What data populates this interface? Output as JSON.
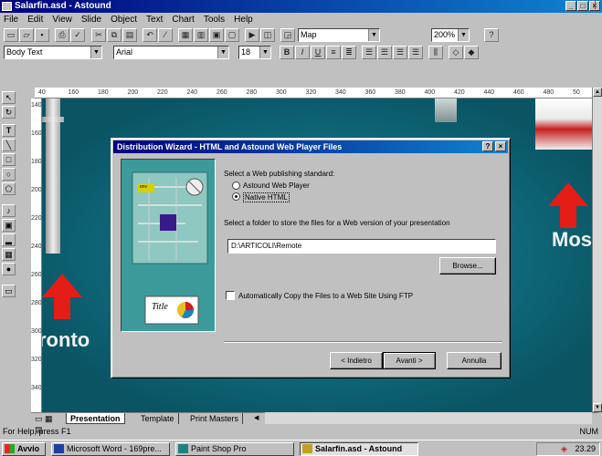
{
  "window": {
    "title": "Salarfin.asd - Astound",
    "controls": [
      "_",
      "□",
      "×"
    ]
  },
  "menu": [
    "File",
    "Edit",
    "View",
    "Slide",
    "Object",
    "Text",
    "Chart",
    "Tools",
    "Help"
  ],
  "toolbar": {
    "view_combo": "Map",
    "zoom_combo": "200%"
  },
  "format_bar": {
    "style_combo": "Body Text",
    "font_combo": "Arial",
    "size_combo": "18",
    "bold": "B",
    "italic": "I",
    "underline": "U"
  },
  "ruler": {
    "h_ticks": [
      "40",
      "160",
      "180",
      "200",
      "220",
      "240",
      "260",
      "280",
      "300",
      "320",
      "340",
      "360",
      "380",
      "400",
      "420",
      "440",
      "460",
      "480",
      "50"
    ],
    "v_ticks": [
      "140",
      "160",
      "180",
      "200",
      "220",
      "240",
      "260",
      "280",
      "300",
      "320",
      "340"
    ]
  },
  "slide": {
    "city_left": "ronto",
    "city_right": "Mosc",
    "colors": {
      "background": "#106f80",
      "arrow": "#e41d16"
    }
  },
  "dialog": {
    "title": "Distribution Wizard - HTML and Astound Web Player Files",
    "help_btn": "?",
    "close_btn": "×",
    "prompt_standard": "Select a Web publishing standard:",
    "option_astound": "Astound Web Player",
    "option_native": "Native HTML",
    "selected_option": "native",
    "prompt_folder": "Select a folder to store the files for a Web version of your presentation",
    "folder_value": "D:\\ARTICOLI\\Remote",
    "browse_btn": "Browse...",
    "ftp_checkbox": "Automatically Copy the Files to a Web Site Using FTP",
    "ftp_checked": false,
    "back_btn": "< Indietro",
    "next_btn": "Avanti >",
    "cancel_btn": "Annulla",
    "thumbnail_title": "Title",
    "badge": "env"
  },
  "tabs": {
    "presentation": "Presentation",
    "template": "Template",
    "print_masters": "Print Masters"
  },
  "status": {
    "help_text": "For Help, press F1",
    "num": "NUM"
  },
  "taskbar": {
    "start": "Avvio",
    "items": [
      "Microsoft Word - 169pre...",
      "Paint Shop Pro",
      "Salarfin.asd - Astound"
    ],
    "clock": "23.29"
  }
}
